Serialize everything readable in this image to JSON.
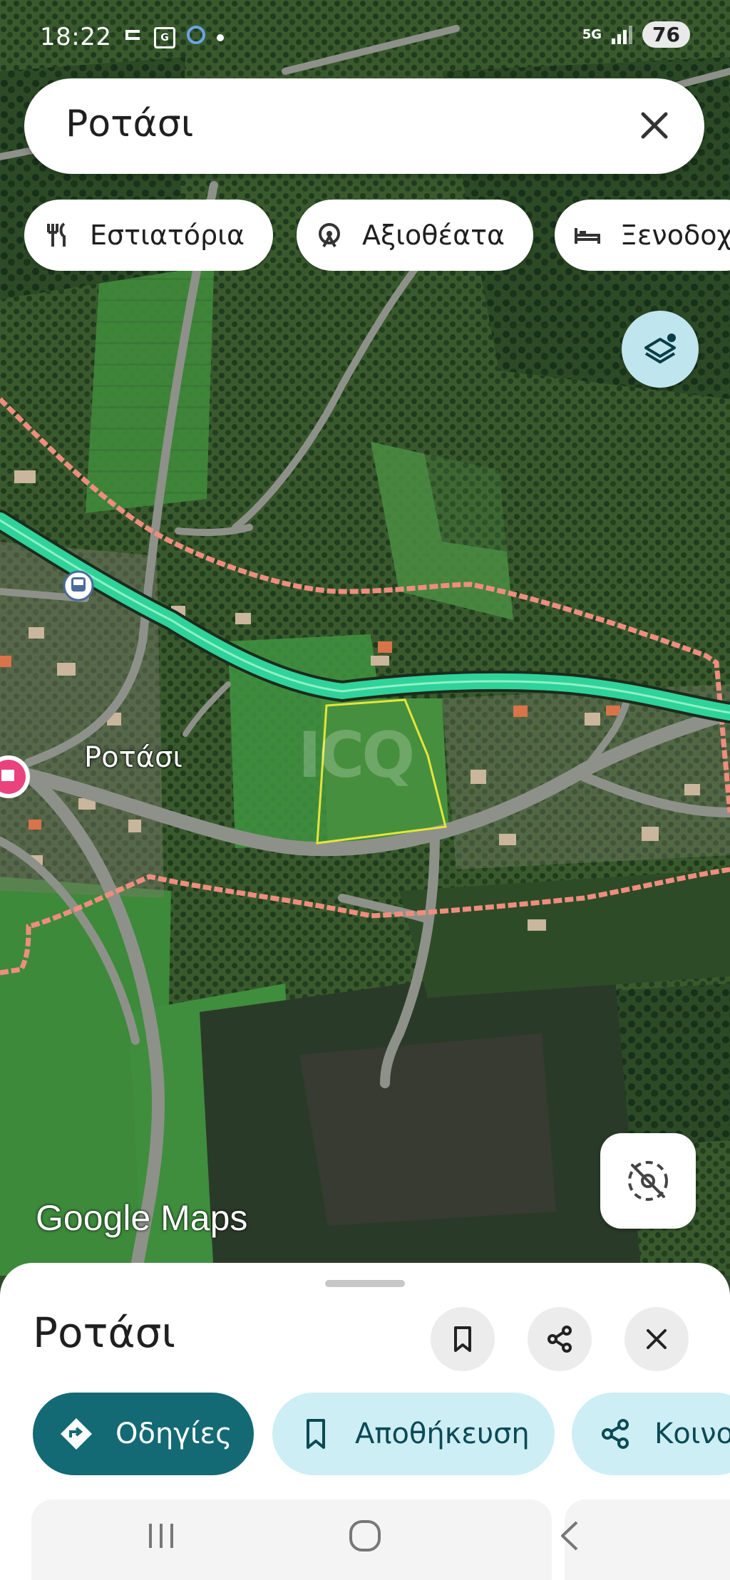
{
  "status_bar": {
    "time": "18:22",
    "network": "5G",
    "battery": "76",
    "icons": [
      "message-icon",
      "ge-icon",
      "app-icon",
      "dot-icon"
    ]
  },
  "search": {
    "value": "Ροτάσι",
    "clear_icon": "close-icon"
  },
  "chips": [
    {
      "label": "Εστιατόρια",
      "icon": "restaurant-icon"
    },
    {
      "label": "Αξιοθέατα",
      "icon": "attraction-icon"
    },
    {
      "label": "Ξενοδοχ",
      "icon": "hotel-icon"
    }
  ],
  "map": {
    "place_label": "Ροτάσι",
    "logo": "Google Maps",
    "watermark": "ICQ",
    "layers_icon": "layers-icon",
    "compass_icon": "compass-icon",
    "colors": {
      "highway": "#2fd39a",
      "road": "#8e9189",
      "boundary": "#ef8d7f",
      "parcel_outline": "#e5e53a"
    }
  },
  "sheet": {
    "title": "Ροτάσι",
    "actions": [
      {
        "icon": "bookmark-icon"
      },
      {
        "icon": "share-icon"
      },
      {
        "icon": "close-icon"
      }
    ],
    "buttons": [
      {
        "label": "Οδηγίες",
        "icon": "directions-icon",
        "style": "primary"
      },
      {
        "label": "Αποθήκευση",
        "icon": "bookmark-icon",
        "style": "secondary"
      },
      {
        "label": "Κοινοπ",
        "icon": "share-icon",
        "style": "secondary"
      }
    ],
    "colors": {
      "primary": "#136a74",
      "secondary": "#cdeef5"
    }
  },
  "nav_bar": {
    "buttons": [
      "recents-icon",
      "home-icon",
      "back-icon"
    ]
  }
}
